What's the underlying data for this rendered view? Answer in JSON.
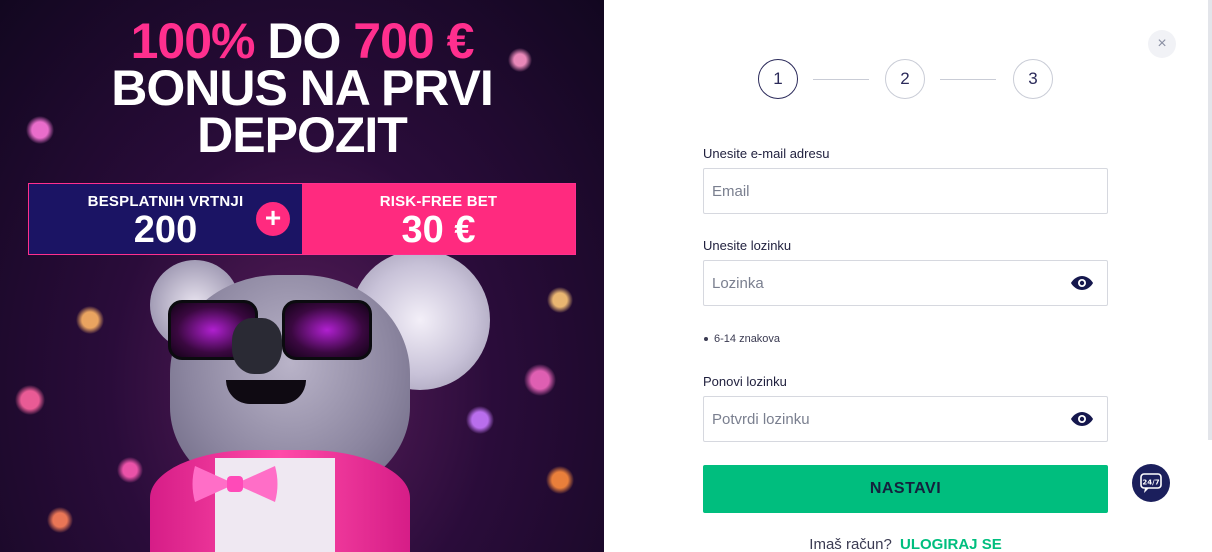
{
  "promo": {
    "headline_part1": "100%",
    "headline_part2": " DO ",
    "headline_part3": "700 €",
    "headline_line2": "BONUS NA PRVI",
    "headline_line3": "DEPOZIT",
    "offer_left_label": "BESPLATNIH VRTNJI",
    "offer_left_value": "200",
    "offer_right_label": "RISK-FREE BET",
    "offer_right_value": "30 €",
    "plus_symbol": "+"
  },
  "modal": {
    "close_symbol": "×",
    "steps": [
      "1",
      "2",
      "3"
    ],
    "active_step": 1
  },
  "form": {
    "email_label": "Unesite e-mail adresu",
    "email_placeholder": "Email",
    "password_label": "Unesite lozinku",
    "password_placeholder": "Lozinka",
    "password_hint": "6-14 znakova",
    "confirm_label": "Ponovi lozinku",
    "confirm_placeholder": "Potvrdi lozinku",
    "submit_label": "NASTAVI",
    "login_prompt": "Imaš račun?",
    "login_link": "ULOGIRAJ SE"
  },
  "chat": {
    "label": "24/7"
  },
  "colors": {
    "accent_pink": "#ff2f8e",
    "navy": "#1b1464",
    "submit_green": "#00be7e"
  }
}
